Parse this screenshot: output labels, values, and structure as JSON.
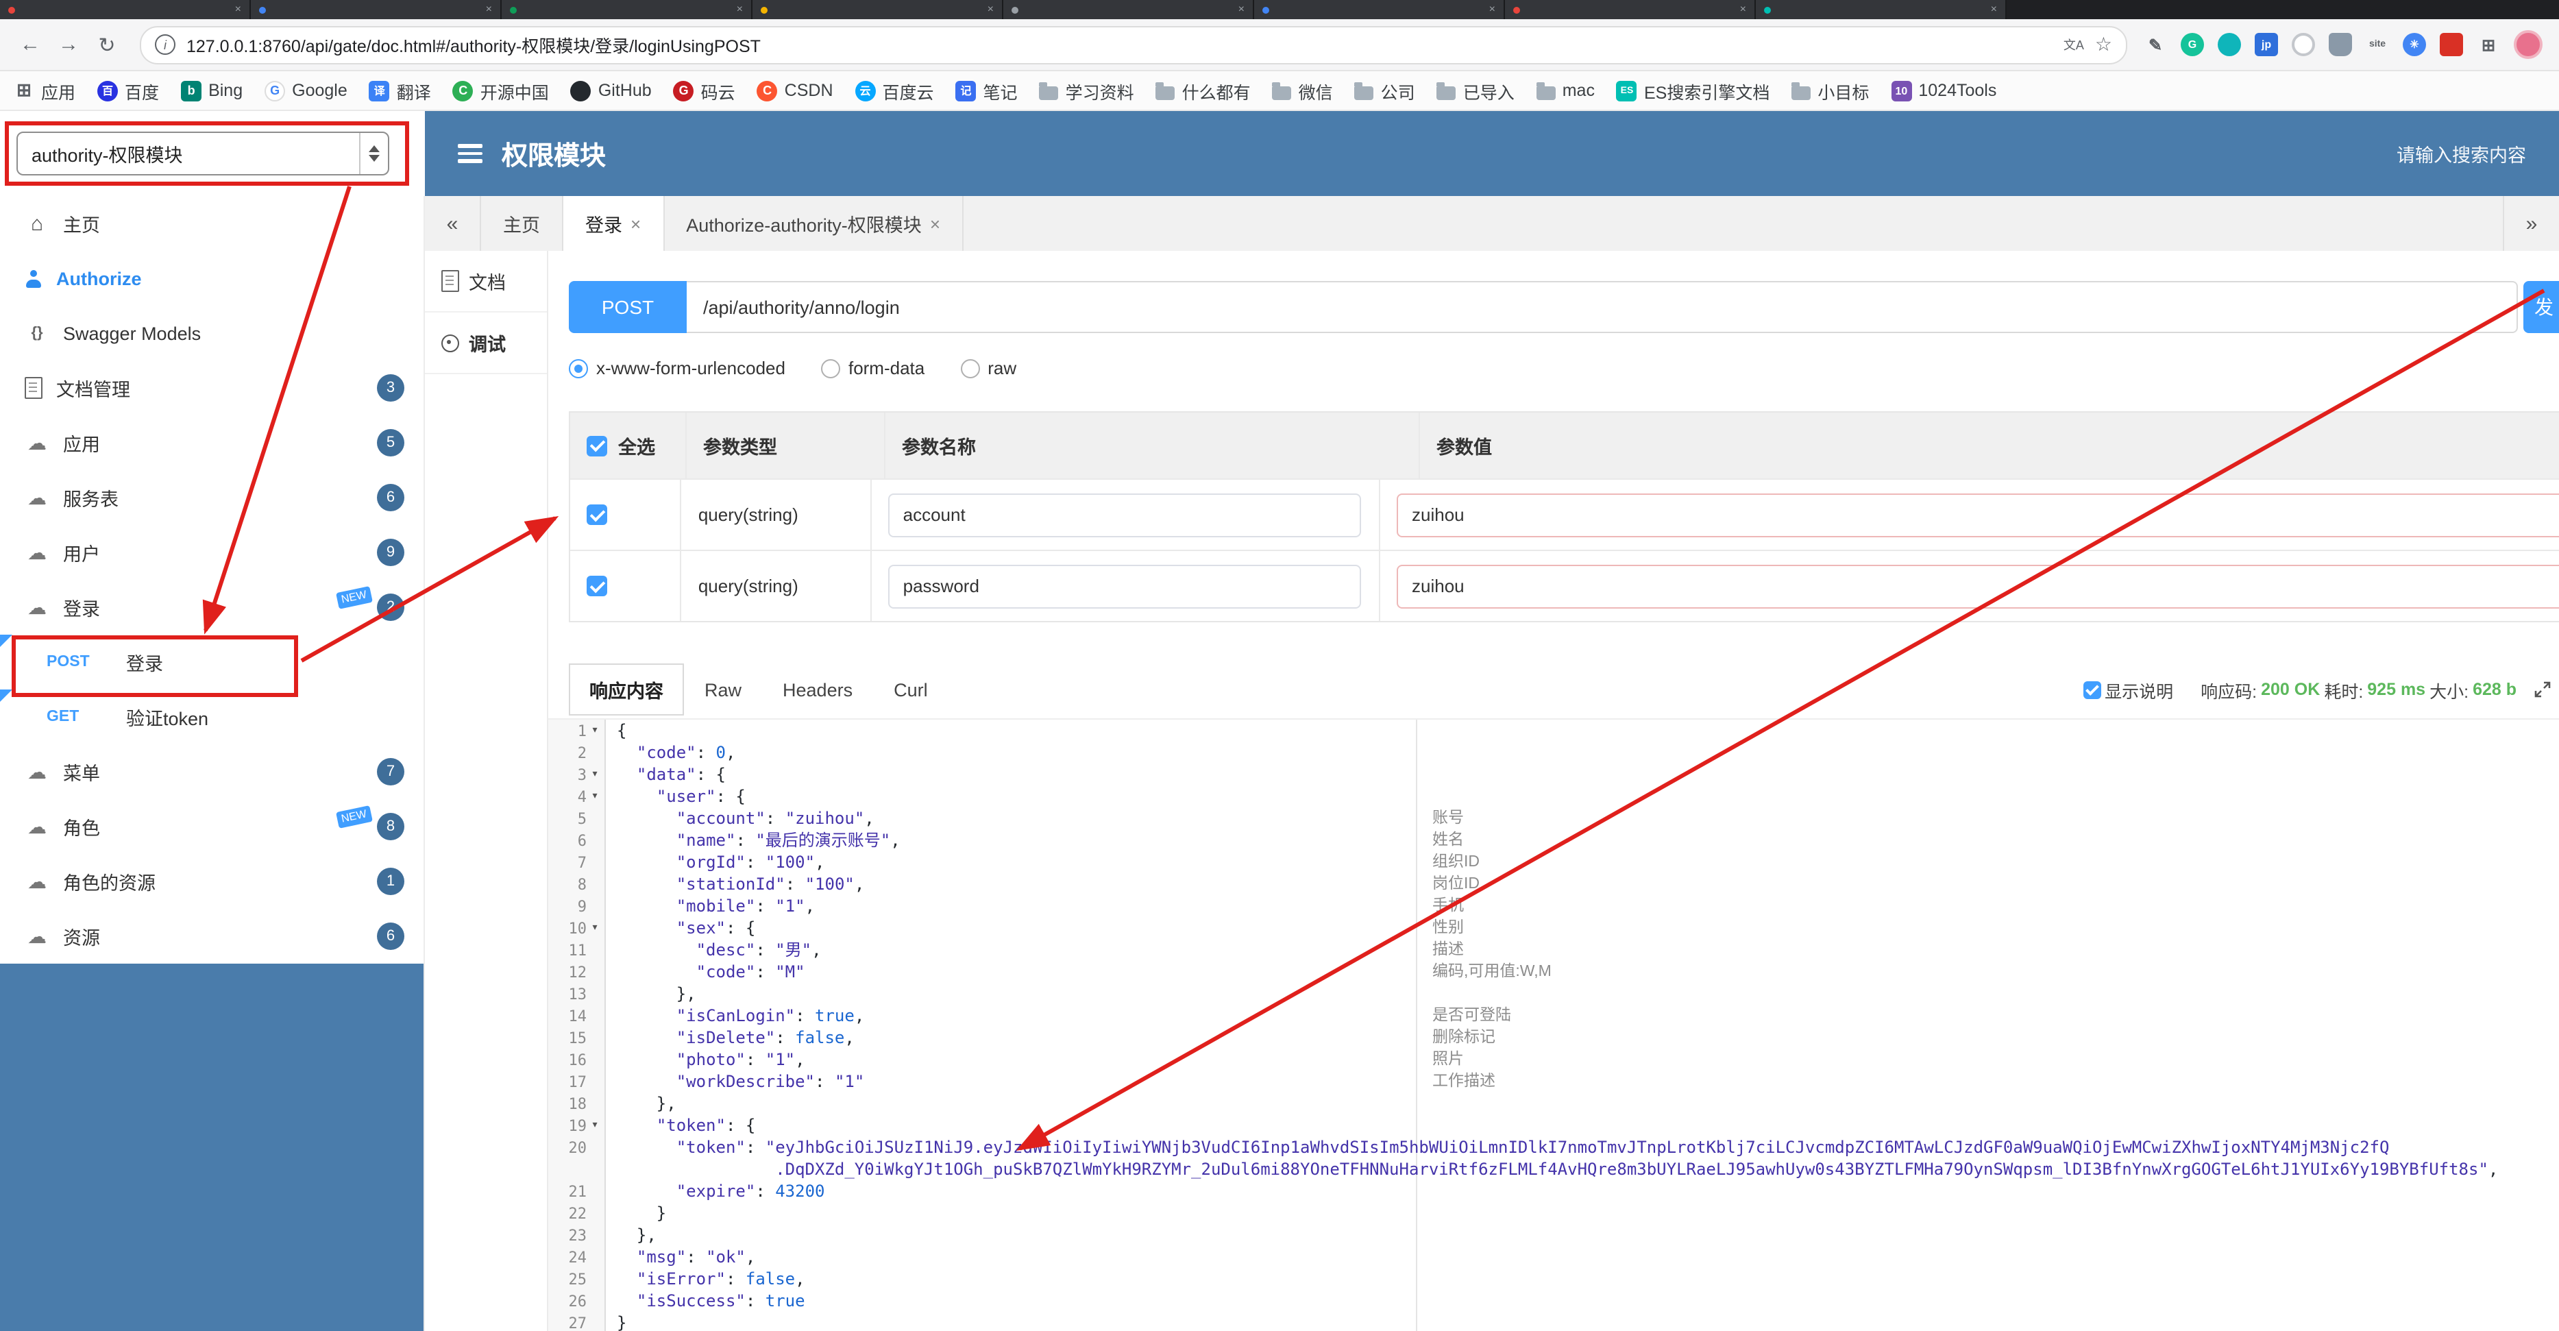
{
  "browser": {
    "url": "127.0.0.1:8760/api/gate/doc.html#/authority-权限模块/登录/loginUsingPOST",
    "bookmarks": [
      {
        "label": "应用",
        "icon_cls": "bic bic-apps",
        "glyph": "⊞"
      },
      {
        "label": "百度",
        "icon_cls": "bic bic-baidu",
        "glyph": "百"
      },
      {
        "label": "Bing",
        "icon_cls": "bic sq bic-bing",
        "glyph": "b"
      },
      {
        "label": "Google",
        "icon_cls": "bic bic-google",
        "glyph": "G"
      },
      {
        "label": "翻译",
        "icon_cls": "bic sq bic-trans",
        "glyph": "译"
      },
      {
        "label": "开源中国",
        "icon_cls": "bic bic-osc",
        "glyph": "C"
      },
      {
        "label": "GitHub",
        "icon_cls": "bic bic-github",
        "glyph": ""
      },
      {
        "label": "码云",
        "icon_cls": "bic bic-gitee",
        "glyph": "G"
      },
      {
        "label": "CSDN",
        "icon_cls": "bic bic-csdn",
        "glyph": "C"
      },
      {
        "label": "百度云",
        "icon_cls": "bic bic-bdy",
        "glyph": "云"
      },
      {
        "label": "笔记",
        "icon_cls": "bic sq bic-note",
        "glyph": "记"
      },
      {
        "label": "学习资料",
        "icon_cls": "bic-folder",
        "glyph": ""
      },
      {
        "label": "什么都有",
        "icon_cls": "bic-folder",
        "glyph": ""
      },
      {
        "label": "微信",
        "icon_cls": "bic-folder",
        "glyph": ""
      },
      {
        "label": "公司",
        "icon_cls": "bic-folder",
        "glyph": ""
      },
      {
        "label": "已导入",
        "icon_cls": "bic-folder",
        "glyph": ""
      },
      {
        "label": "mac",
        "icon_cls": "bic-folder",
        "glyph": ""
      },
      {
        "label": "ES搜索引擎文档",
        "icon_cls": "bic sq bic-es",
        "glyph": "ES"
      },
      {
        "label": "小目标",
        "icon_cls": "bic-folder",
        "glyph": ""
      },
      {
        "label": "1024Tools",
        "icon_cls": "bic sq bic-1024",
        "glyph": "10"
      }
    ]
  },
  "header": {
    "select_value": "authority-权限模块",
    "title": "权限模块",
    "search_placeholder": "请输入搜索内容"
  },
  "sidebar": {
    "items": [
      {
        "cls": "sb-item",
        "icon_cls": "sbi ico-home",
        "label": "主页"
      },
      {
        "cls": "sb-item sb-auth",
        "icon_cls": "sbi ico-person",
        "label": "Authorize"
      },
      {
        "cls": "sb-item",
        "icon_cls": "sbi ico-braces",
        "label": "Swagger Models"
      },
      {
        "cls": "sb-item",
        "icon_cls": "sbi ico-docpg",
        "label": "文档管理",
        "badge": "3"
      },
      {
        "cls": "sb-item",
        "icon_cls": "sbi ico-cloud",
        "label": "应用",
        "badge": "5"
      },
      {
        "cls": "sb-item",
        "icon_cls": "sbi ico-cloud",
        "label": "服务表",
        "badge": "6"
      },
      {
        "cls": "sb-item",
        "icon_cls": "sbi ico-cloud",
        "label": "用户",
        "badge": "9"
      },
      {
        "cls": "sb-item",
        "icon_cls": "sbi ico-cloud",
        "label": "登录",
        "badge": "2",
        "new_label": "NEW"
      },
      {
        "cls": "sb-item sb-sub",
        "icon_cls": "sbi ico-none",
        "method": "POST",
        "label": "登录"
      },
      {
        "cls": "sb-item sb-sub",
        "icon_cls": "sbi ico-none",
        "method": "GET",
        "label": "验证token"
      },
      {
        "cls": "sb-item",
        "icon_cls": "sbi ico-cloud",
        "label": "菜单",
        "badge": "7"
      },
      {
        "cls": "sb-item",
        "icon_cls": "sbi ico-cloud",
        "label": "角色",
        "badge": "8",
        "new_label": "NEW"
      },
      {
        "cls": "sb-item",
        "icon_cls": "sbi ico-cloud",
        "label": "角色的资源",
        "badge": "1"
      },
      {
        "cls": "sb-item",
        "icon_cls": "sbi ico-cloud",
        "label": "资源",
        "badge": "6"
      }
    ]
  },
  "doc_tabs": {
    "collapse": "«",
    "expand": "»",
    "tabs": [
      {
        "label": "主页"
      },
      {
        "label": "登录"
      },
      {
        "label": "Authorize-authority-权限模块"
      }
    ]
  },
  "rail": {
    "doc_label": "文档",
    "debug_label": "调试"
  },
  "debug": {
    "method": "POST",
    "path": "/api/authority/anno/login",
    "send_label": "发",
    "content_types": [
      "x-www-form-urlencoded",
      "form-data",
      "raw"
    ],
    "params": {
      "select_all": "全选",
      "col_type": "参数类型",
      "col_name": "参数名称",
      "col_value": "参数值",
      "rows": [
        {
          "type": "query(string)",
          "name": "account",
          "value": "zuihou"
        },
        {
          "type": "query(string)",
          "name": "password",
          "value": "zuihou"
        }
      ]
    }
  },
  "response": {
    "tabs": [
      "响应内容",
      "Raw",
      "Headers",
      "Curl"
    ],
    "show_desc": "显示说明",
    "status_label": "响应码:",
    "status_value": "200 OK",
    "time_label": "耗时:",
    "time_value": "925 ms",
    "size_label": "大小:",
    "size_value": "628 b",
    "lines": [
      {
        "n": "1",
        "fold": true,
        "seg": [
          [
            "p",
            "{"
          ]
        ]
      },
      {
        "n": "2",
        "seg": [
          [
            "p",
            "  "
          ],
          [
            "k",
            "\"code\""
          ],
          [
            "p",
            ": "
          ],
          [
            "n",
            "0"
          ],
          [
            "p",
            ","
          ]
        ]
      },
      {
        "n": "3",
        "fold": true,
        "seg": [
          [
            "p",
            "  "
          ],
          [
            "k",
            "\"data\""
          ],
          [
            "p",
            ": {"
          ]
        ]
      },
      {
        "n": "4",
        "fold": true,
        "seg": [
          [
            "p",
            "    "
          ],
          [
            "k",
            "\"user\""
          ],
          [
            "p",
            ": {"
          ]
        ]
      },
      {
        "n": "5",
        "seg": [
          [
            "p",
            "      "
          ],
          [
            "k",
            "\"account\""
          ],
          [
            "p",
            ": "
          ],
          [
            "s",
            "\"zuihou\""
          ],
          [
            "p",
            ","
          ]
        ],
        "note": "账号"
      },
      {
        "n": "6",
        "seg": [
          [
            "p",
            "      "
          ],
          [
            "k",
            "\"name\""
          ],
          [
            "p",
            ": "
          ],
          [
            "s",
            "\"最后的演示账号\""
          ],
          [
            "p",
            ","
          ]
        ],
        "note": "姓名"
      },
      {
        "n": "7",
        "seg": [
          [
            "p",
            "      "
          ],
          [
            "k",
            "\"orgId\""
          ],
          [
            "p",
            ": "
          ],
          [
            "s",
            "\"100\""
          ],
          [
            "p",
            ","
          ]
        ],
        "note": "组织ID"
      },
      {
        "n": "8",
        "seg": [
          [
            "p",
            "      "
          ],
          [
            "k",
            "\"stationId\""
          ],
          [
            "p",
            ": "
          ],
          [
            "s",
            "\"100\""
          ],
          [
            "p",
            ","
          ]
        ],
        "note": "岗位ID"
      },
      {
        "n": "9",
        "seg": [
          [
            "p",
            "      "
          ],
          [
            "k",
            "\"mobile\""
          ],
          [
            "p",
            ": "
          ],
          [
            "s",
            "\"1\""
          ],
          [
            "p",
            ","
          ]
        ],
        "note": "手机"
      },
      {
        "n": "10",
        "fold": true,
        "seg": [
          [
            "p",
            "      "
          ],
          [
            "k",
            "\"sex\""
          ],
          [
            "p",
            ": {"
          ]
        ],
        "note": "性别"
      },
      {
        "n": "11",
        "seg": [
          [
            "p",
            "        "
          ],
          [
            "k",
            "\"desc\""
          ],
          [
            "p",
            ": "
          ],
          [
            "s",
            "\"男\""
          ],
          [
            "p",
            ","
          ]
        ],
        "note": "描述"
      },
      {
        "n": "12",
        "seg": [
          [
            "p",
            "        "
          ],
          [
            "k",
            "\"code\""
          ],
          [
            "p",
            ": "
          ],
          [
            "s",
            "\"M\""
          ]
        ],
        "note": "编码,可用值:W,M"
      },
      {
        "n": "13",
        "seg": [
          [
            "p",
            "      },"
          ]
        ]
      },
      {
        "n": "14",
        "seg": [
          [
            "p",
            "      "
          ],
          [
            "k",
            "\"isCanLogin\""
          ],
          [
            "p",
            ": "
          ],
          [
            "b",
            "true"
          ],
          [
            "p",
            ","
          ]
        ],
        "note": "是否可登陆"
      },
      {
        "n": "15",
        "seg": [
          [
            "p",
            "      "
          ],
          [
            "k",
            "\"isDelete\""
          ],
          [
            "p",
            ": "
          ],
          [
            "b",
            "false"
          ],
          [
            "p",
            ","
          ]
        ],
        "note": "删除标记"
      },
      {
        "n": "16",
        "seg": [
          [
            "p",
            "      "
          ],
          [
            "k",
            "\"photo\""
          ],
          [
            "p",
            ": "
          ],
          [
            "s",
            "\"1\""
          ],
          [
            "p",
            ","
          ]
        ],
        "note": "照片"
      },
      {
        "n": "17",
        "seg": [
          [
            "p",
            "      "
          ],
          [
            "k",
            "\"workDescribe\""
          ],
          [
            "p",
            ": "
          ],
          [
            "s",
            "\"1\""
          ]
        ],
        "note": "工作描述"
      },
      {
        "n": "18",
        "seg": [
          [
            "p",
            "    },"
          ]
        ]
      },
      {
        "n": "19",
        "fold": true,
        "seg": [
          [
            "p",
            "    "
          ],
          [
            "k",
            "\"token\""
          ],
          [
            "p",
            ": {"
          ]
        ]
      },
      {
        "n": "20",
        "seg": [
          [
            "p",
            "      "
          ],
          [
            "k",
            "\"token\""
          ],
          [
            "p",
            ": "
          ],
          [
            "s",
            "\"eyJhbGciOiJSUzI1NiJ9.eyJzdWIiOiIyIiwiYWNjb3VudCI6Inp1aWhvdSIsIm5hbWUiOiLmnIDlkI7nmoTmvJTnpLrotKblj7ciLCJvcmdpZCI6MTAwLCJzdGF0aW9uaWQiOjEwMCwiZXhwIjoxNTY4MjM3Njc2fQ"
          ]
        ]
      },
      {
        "n": "",
        "seg": [
          [
            "p",
            "                "
          ],
          [
            "s",
            ".DqDXZd_Y0iWkgYJt1OGh_puSkB7QZlWmYkH9RZYMr_2uDul6mi88YOneTFHNNuHarviRtf6zFLMLf4AvHQre8m3bUYLRaeLJ95awhUyw0s43BYZTLFMHa79OynSWqpsm_lDI3BfnYnwXrgGOGTeL6htJ1YUIx6Yy19BYBfUft8s\""
          ],
          [
            "p",
            ","
          ]
        ]
      },
      {
        "n": "21",
        "seg": [
          [
            "p",
            "      "
          ],
          [
            "k",
            "\"expire\""
          ],
          [
            "p",
            ": "
          ],
          [
            "n",
            "43200"
          ]
        ]
      },
      {
        "n": "22",
        "seg": [
          [
            "p",
            "    }"
          ]
        ]
      },
      {
        "n": "23",
        "seg": [
          [
            "p",
            "  },"
          ]
        ]
      },
      {
        "n": "24",
        "seg": [
          [
            "p",
            "  "
          ],
          [
            "k",
            "\"msg\""
          ],
          [
            "p",
            ": "
          ],
          [
            "s",
            "\"ok\""
          ],
          [
            "p",
            ","
          ]
        ]
      },
      {
        "n": "25",
        "seg": [
          [
            "p",
            "  "
          ],
          [
            "k",
            "\"isError\""
          ],
          [
            "p",
            ": "
          ],
          [
            "b",
            "false"
          ],
          [
            "p",
            ","
          ]
        ]
      },
      {
        "n": "26",
        "seg": [
          [
            "p",
            "  "
          ],
          [
            "k",
            "\"isSuccess\""
          ],
          [
            "p",
            ": "
          ],
          [
            "b",
            "true"
          ]
        ]
      },
      {
        "n": "27",
        "seg": [
          [
            "p",
            "}"
          ]
        ]
      }
    ]
  }
}
